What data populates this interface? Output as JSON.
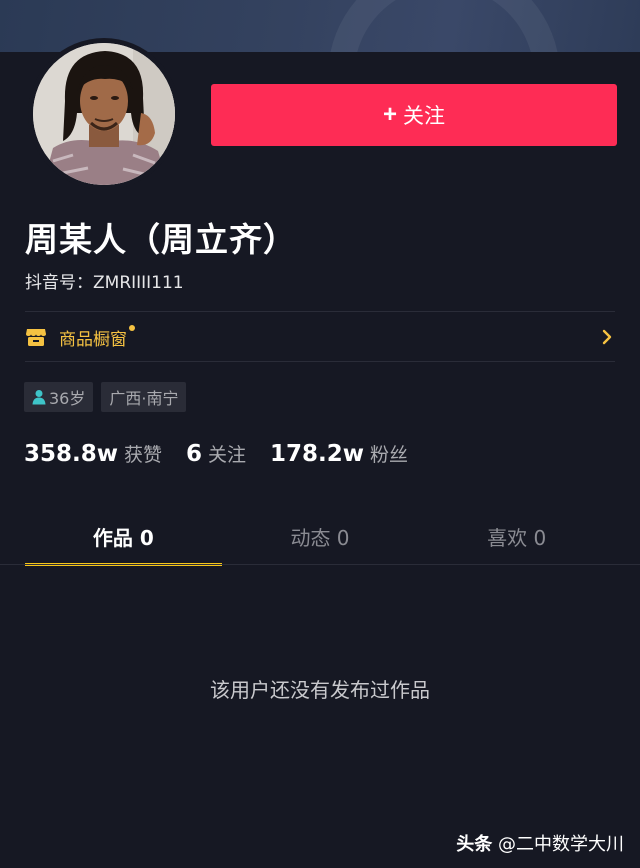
{
  "profile": {
    "name": "周某人（周立齐）",
    "douyin_id": "抖音号：ZMRIIII111"
  },
  "actions": {
    "follow_plus": "+",
    "follow_label": "关注"
  },
  "shop": {
    "label": "商品橱窗",
    "arrow": "›"
  },
  "tags": [
    {
      "label": "36岁",
      "icon": "person-icon"
    },
    {
      "label": "广西·南宁"
    }
  ],
  "stats": [
    {
      "value": "358.8w",
      "label": "获赞"
    },
    {
      "value": "6",
      "label": "关注"
    },
    {
      "value": "178.2w",
      "label": "粉丝"
    }
  ],
  "tabs": [
    {
      "label": "作品 0",
      "active": true
    },
    {
      "label": "动态 0",
      "active": false
    },
    {
      "label": "喜欢 0",
      "active": false
    }
  ],
  "empty_state": "该用户还没有发布过作品",
  "watermark": {
    "brand": "头条",
    "handle": "@二中数学大川"
  },
  "colors": {
    "background": "#161823",
    "follow_button": "#fe2c55",
    "shop_accent": "#f5c242",
    "tab_indicator": "#f5c518"
  }
}
